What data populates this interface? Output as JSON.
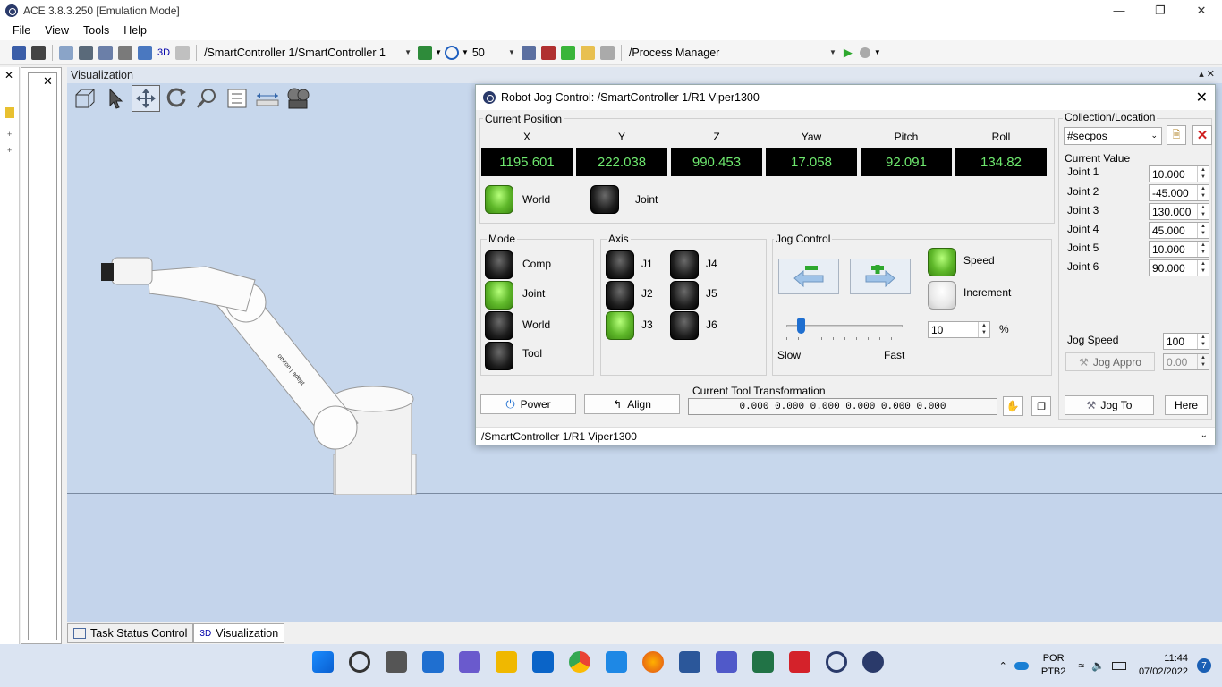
{
  "window": {
    "title": "ACE 3.8.3.250 [Emulation Mode]"
  },
  "menu": [
    "File",
    "View",
    "Tools",
    "Help"
  ],
  "toolbar": {
    "label_3d": "3D",
    "controller_path": "/SmartController 1/SmartController 1",
    "speed_value": "50",
    "process_manager": "/Process Manager"
  },
  "viz": {
    "header": "Visualization"
  },
  "dialog": {
    "title": "Robot Jog Control: /SmartController 1/R1 Viper1300",
    "current_position_label": "Current Position",
    "columns": [
      {
        "name": "X",
        "value": "1195.601"
      },
      {
        "name": "Y",
        "value": "222.038"
      },
      {
        "name": "Z",
        "value": "990.453"
      },
      {
        "name": "Yaw",
        "value": "17.058"
      },
      {
        "name": "Pitch",
        "value": "92.091"
      },
      {
        "name": "Roll",
        "value": "134.82"
      }
    ],
    "frame": {
      "world": "World",
      "joint": "Joint"
    },
    "mode": {
      "label": "Mode",
      "items": [
        "Comp",
        "Joint",
        "World",
        "Tool"
      ],
      "active": "Joint"
    },
    "axis": {
      "label": "Axis",
      "items": [
        "J1",
        "J2",
        "J3",
        "J4",
        "J5",
        "J6"
      ],
      "active": "J3"
    },
    "jog_control": {
      "label": "Jog Control",
      "speed_label": "Speed",
      "increment_label": "Increment",
      "slow_label": "Slow",
      "fast_label": "Fast",
      "percent_value": "10",
      "percent_sign": "%",
      "slider_fraction": 0.12
    },
    "collection": {
      "label": "Collection/Location",
      "selected": "#secpos"
    },
    "current_value": {
      "label": "Current Value",
      "joints": [
        {
          "name": "Joint 1",
          "value": "10.000"
        },
        {
          "name": "Joint 2",
          "value": "-45.000"
        },
        {
          "name": "Joint 3",
          "value": "130.000"
        },
        {
          "name": "Joint 4",
          "value": "45.000"
        },
        {
          "name": "Joint 5",
          "value": "10.000"
        },
        {
          "name": "Joint 6",
          "value": "90.000"
        }
      ]
    },
    "jog_speed": {
      "label": "Jog Speed",
      "value": "100"
    },
    "jog_appro": {
      "label": "Jog Appro",
      "value": "0.00"
    },
    "power_label": "Power",
    "align_label": "Align",
    "tool_transform": {
      "label": "Current Tool Transformation",
      "value": "0.000 0.000 0.000 0.000 0.000 0.000"
    },
    "jog_to_label": "Jog To",
    "here_label": "Here",
    "footer_path": "/SmartController 1/R1 Viper1300"
  },
  "bottom_tabs": [
    {
      "label": "Task Status Control",
      "active": false
    },
    {
      "label": "Visualization",
      "icon_text": "3D",
      "active": true
    }
  ],
  "taskbar": {
    "lang_line1": "POR",
    "lang_line2": "PTB2",
    "time": "11:44",
    "date": "07/02/2022",
    "notification_count": "7"
  },
  "colors": {
    "accent_green": "#5fb82a",
    "readout_text": "#6ee86e",
    "viz_background": "#c7d7ec"
  }
}
